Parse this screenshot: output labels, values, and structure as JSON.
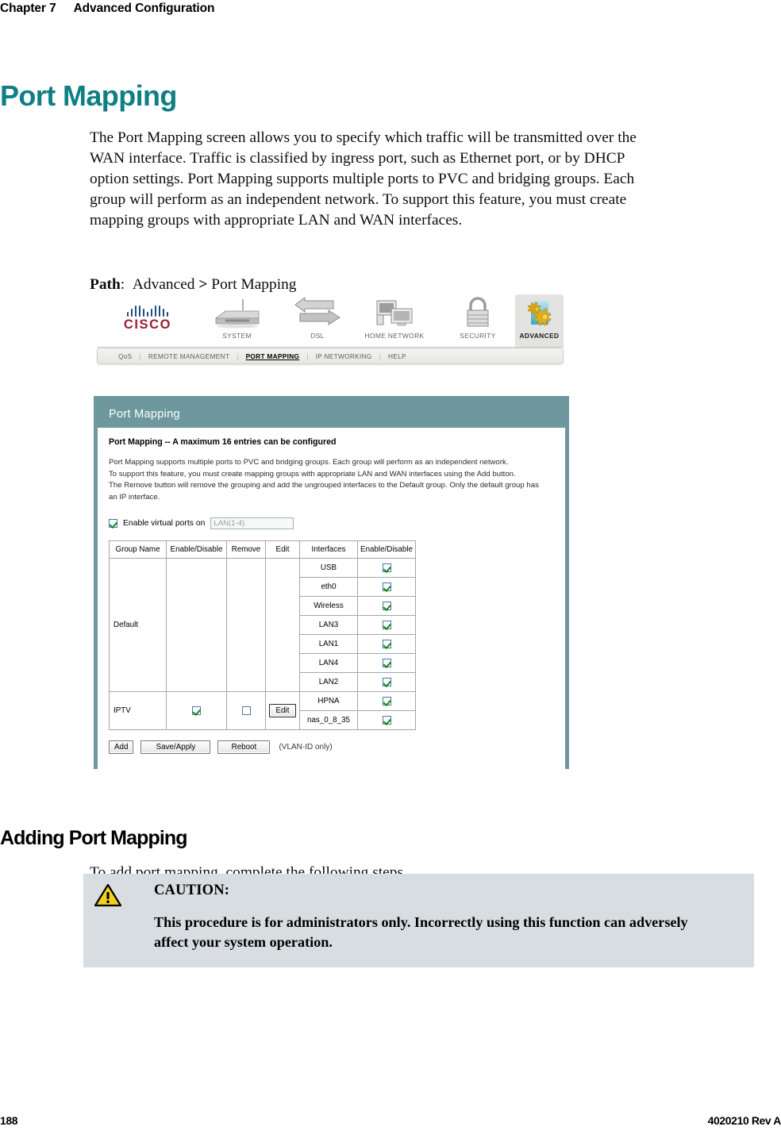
{
  "page_header": {
    "chapter": "Chapter 7",
    "title": "Advanced Configuration"
  },
  "heading_1": "Port Mapping",
  "intro_paragraph": "The Port Mapping screen allows you to specify which traffic will be transmitted over the WAN interface. Traffic is classified by ingress port, such as Ethernet port, or by DHCP option settings. Port Mapping supports multiple ports to PVC and bridging groups. Each group will perform as an independent network. To support this feature, you must create mapping groups with appropriate LAN and WAN interfaces.",
  "path": {
    "label": "Path",
    "separator": ":",
    "first": "Advanced",
    "arrow": ">",
    "second": "Port Mapping"
  },
  "router_ui": {
    "brand": "CISCO",
    "primary_nav": [
      {
        "label": "SYSTEM",
        "icon": "router-icon",
        "active": false
      },
      {
        "label": "DSL",
        "icon": "arrows-exchange-icon",
        "active": false
      },
      {
        "label": "HOME NETWORK",
        "icon": "computers-icon",
        "active": false
      },
      {
        "label": "SECURITY",
        "icon": "padlock-icon",
        "active": false
      },
      {
        "label": "ADVANCED",
        "icon": "gears-icon",
        "active": true
      }
    ],
    "sub_nav": [
      {
        "label": "QoS",
        "current": false
      },
      {
        "label": "REMOTE MANAGEMENT",
        "current": false
      },
      {
        "label": "PORT MAPPING",
        "current": true
      },
      {
        "label": "IP NETWORKING",
        "current": false
      },
      {
        "label": "HELP",
        "current": false
      }
    ],
    "panel": {
      "title": "Port Mapping",
      "subtitle": "Port Mapping -- A maximum 16 entries can be configured",
      "description_lines": [
        "Port Mapping supports multiple ports to PVC and bridging groups. Each group will perform as an independent network.",
        "To support this feature, you must create mapping groups with appropriate LAN and WAN interfaces using the Add button.",
        "The Remove button will remove the grouping and add the ungrouped interfaces to the Default group. Only the default group has",
        "an IP interface."
      ],
      "virtual_ports": {
        "checked": true,
        "label": "Enable virtual ports on",
        "value": "LAN(1-4)"
      },
      "table": {
        "headers": [
          "Group Name",
          "Enable/Disable",
          "Remove",
          "Edit",
          "Interfaces",
          "Enable/Disable"
        ],
        "groups": [
          {
            "group_name": "Default",
            "enable_disable": null,
            "remove": null,
            "edit": null,
            "interfaces": [
              {
                "name": "USB",
                "enabled": true
              },
              {
                "name": "eth0",
                "enabled": true
              },
              {
                "name": "Wireless",
                "enabled": true
              },
              {
                "name": "LAN3",
                "enabled": true
              },
              {
                "name": "LAN1",
                "enabled": true
              },
              {
                "name": "LAN4",
                "enabled": true
              },
              {
                "name": "LAN2",
                "enabled": true
              }
            ]
          },
          {
            "group_name": "IPTV",
            "enable_disable": true,
            "remove": false,
            "edit": "Edit",
            "interfaces": [
              {
                "name": "HPNA",
                "enabled": true
              },
              {
                "name": "nas_0_8_35",
                "enabled": true
              }
            ]
          }
        ]
      },
      "buttons": [
        {
          "label": "Add"
        },
        {
          "label": "Save/Apply"
        },
        {
          "label": "Reboot"
        }
      ],
      "buttons_note": "(VLAN-ID only)"
    }
  },
  "heading_2": "Adding Port Mapping",
  "steps_intro": "To add port mapping, complete the following steps.",
  "caution": {
    "icon": "warning-triangle-icon",
    "title": "CAUTION:",
    "text": "This procedure is for administrators only. Incorrectly using this function can adversely affect your system operation."
  },
  "footer": {
    "page_number": "188",
    "doc_id": "4020210 Rev A"
  },
  "colors": {
    "heading_teal": "#0f7f84",
    "panel_teal": "#6e989d",
    "caution_bg": "#d7dde0",
    "warning_yellow": "#f5cf1e"
  }
}
